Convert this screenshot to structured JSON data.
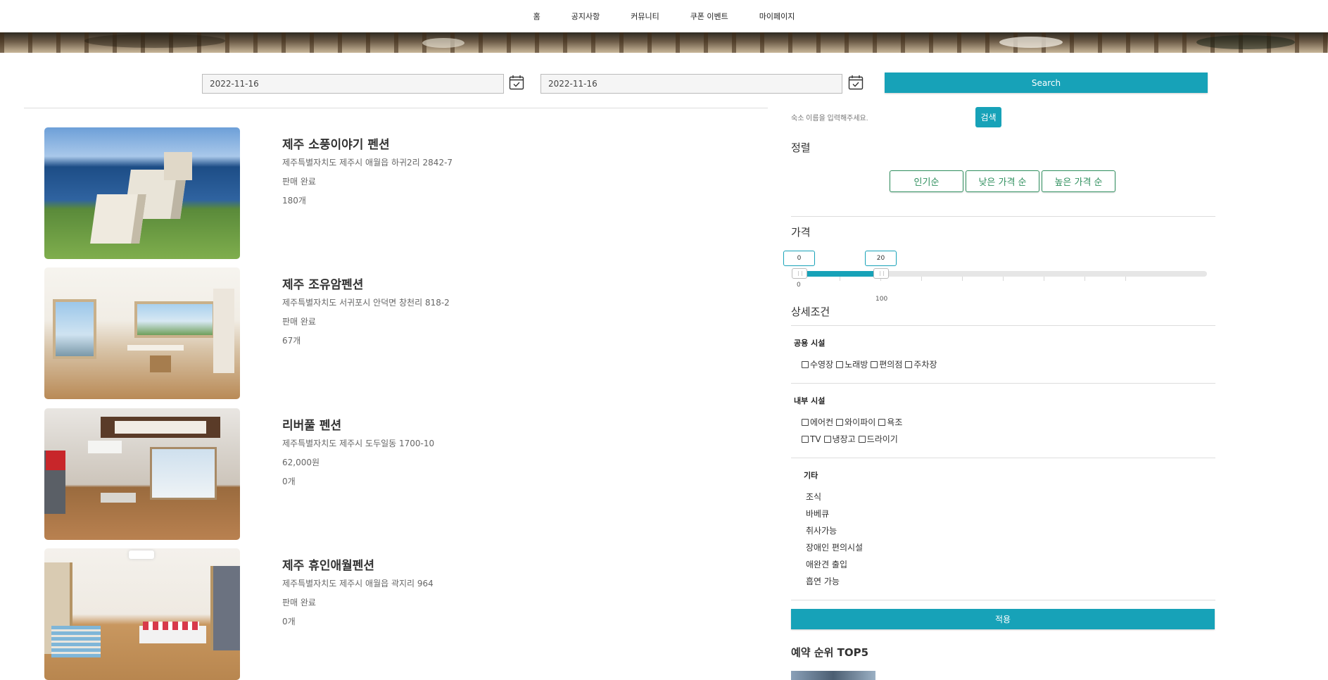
{
  "nav": {
    "items": [
      "홈",
      "공지사항",
      "커뮤니티",
      "쿠폰 이벤트",
      "마이페이지"
    ]
  },
  "search_bar": {
    "checkin": "2022-11-16",
    "checkout": "2022-11-16",
    "search_label": "Search"
  },
  "listings": [
    {
      "name": "제주 소풍이야기 펜션",
      "address": "제주특별자치도 제주시 애월읍 하귀2리 2842-7",
      "price": "판매 완료",
      "count": "180개"
    },
    {
      "name": "제주 조유암펜션",
      "address": "제주특별자치도 서귀포시 안덕면 창천리 818-2",
      "price": "판매 완료",
      "count": "67개"
    },
    {
      "name": "리버풀 펜션",
      "address": "제주특별자치도 제주시 도두일동 1700-10",
      "price": "62,000원",
      "count": "0개"
    },
    {
      "name": "제주 휴인애월펜션",
      "address": "제주특별자치도 제주시 애월읍 곽지리 964",
      "price": "판매 완료",
      "count": "0개"
    }
  ],
  "sidebar": {
    "keyword_placeholder": "숙소 이름을 입력해주세요.",
    "keyword_button": "검색",
    "sort_title": "정렬",
    "sort_options": [
      "인기순",
      "낮은 가격 순",
      "높은 가격 순"
    ],
    "price_title": "가격",
    "price_min": "0",
    "price_max": "20",
    "range_min_label": "0",
    "range_max_label": "100",
    "detail_title": "상세조건",
    "shared_title": "공용 시설",
    "shared": [
      "수영장",
      "노래방",
      "편의점",
      "주차장"
    ],
    "inner_title": "내부 시설",
    "inner_row1": [
      "에어컨",
      "와이파이",
      "욕조"
    ],
    "inner_row2": [
      "TV",
      "냉장고",
      "드라이기"
    ],
    "etc_title": "기타",
    "etc": [
      "조식",
      "바베큐",
      "취사가능",
      "장애인 편의시설",
      "애완견 출입",
      "흡연 가능"
    ],
    "apply_label": "적용",
    "top5_title": "예약 순위 TOP5"
  },
  "colors": {
    "accent": "#17a2b8",
    "sort_green": "#2f8f5e"
  }
}
